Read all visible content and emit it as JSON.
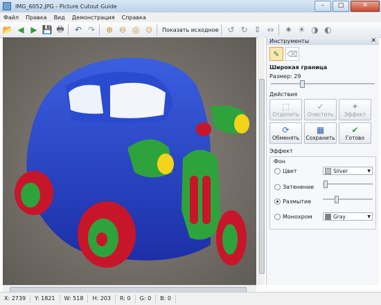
{
  "window": {
    "title": "IMG_6052.JPG - Picture Cutout Guide",
    "buttons": {
      "minimize": "–",
      "maximize": "□",
      "close": "✕"
    }
  },
  "menu": [
    "Файл",
    "Правка",
    "Вид",
    "Демонстрация",
    "Справка"
  ],
  "toolbar": {
    "show_original_label": "Показать исходное",
    "icons": {
      "open": "📂",
      "back": "◀",
      "forward": "▶",
      "save": "💾",
      "print": "🖶",
      "undo": "↶",
      "redo": "↷",
      "zoom_in": "⊕",
      "zoom_out": "⊖",
      "zoom_fit": "◎",
      "zoom_actual": "⊙",
      "rotate_left": "↺",
      "rotate_right": "↻",
      "flip_v": "⇕",
      "flip_h": "⇔",
      "settings": "✷",
      "brightness": "☀",
      "color": "◑",
      "contrast": "◐"
    }
  },
  "panel": {
    "title": "Инструменты",
    "close_icon": "✕",
    "tools": {
      "brush_icon": "✎",
      "eraser_icon": "⌫"
    },
    "tool_name": "Широкая граница",
    "size_label": "Размер: 29",
    "size_value": 29,
    "actions_title": "Действия",
    "actions": [
      {
        "label": "Отделить",
        "icon": "⬚",
        "enabled": false
      },
      {
        "label": "Очистить",
        "icon": "✓",
        "enabled": false
      },
      {
        "label": "Эффект",
        "icon": "✦",
        "enabled": false
      },
      {
        "label": "Обменять",
        "icon": "⟳",
        "enabled": true
      },
      {
        "label": "Сохранить",
        "icon": "▦",
        "enabled": true
      },
      {
        "label": "Готово",
        "icon": "✔",
        "enabled": true
      }
    ],
    "effect_title": "Эффект",
    "background_title": "Фон",
    "options": [
      {
        "label": "Цвет",
        "selected": false
      },
      {
        "label": "Затенение",
        "selected": false
      },
      {
        "label": "Размытие",
        "selected": true
      },
      {
        "label": "Монохром",
        "selected": false
      }
    ],
    "color_combo": {
      "value": "Silver",
      "color": "#c0c0c0"
    },
    "mono_combo": {
      "value": "Gray",
      "color": "#808080"
    },
    "shade_level": 0.02,
    "blur_level": 0.25
  },
  "status": {
    "x": "X: 2739",
    "y": "Y: 1821",
    "w": "W: 518",
    "h": "H: 203",
    "r": "R: 0",
    "g": "G: 0",
    "b": "B: 0"
  }
}
